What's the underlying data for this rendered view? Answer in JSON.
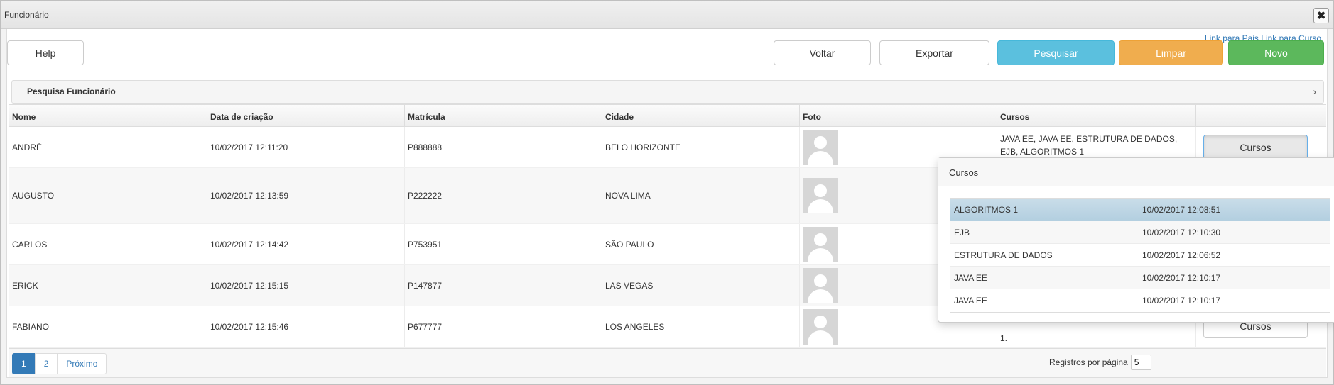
{
  "window": {
    "title": "Funcionário",
    "close_glyph": "✖"
  },
  "links": {
    "pais": "Link para Pais",
    "curso": "Link para Curso"
  },
  "toolbar": {
    "help": "Help",
    "voltar": "Voltar",
    "exportar": "Exportar",
    "pesquisar": "Pesquisar",
    "limpar": "Limpar",
    "novo": "Novo"
  },
  "search_panel": {
    "title": "Pesquisa Funcionário",
    "chevron": "›"
  },
  "table": {
    "headers": [
      "Nome",
      "Data de criação",
      "Matrícula",
      "Cidade",
      "Foto",
      "Cursos",
      ""
    ],
    "rows": [
      {
        "nome": "ANDRÉ",
        "data": "10/02/2017 12:11:20",
        "matricula": "P888888",
        "cidade": "BELO HORIZONTE",
        "cursos": "JAVA EE, JAVA EE, ESTRUTURA DE DADOS, EJB, ALGORITMOS 1",
        "button": "Cursos"
      },
      {
        "nome": "AUGUSTO",
        "data": "10/02/2017 12:13:59",
        "matricula": "P222222",
        "cidade": "NOVA LIMA",
        "cursos": "",
        "button": ""
      },
      {
        "nome": "CARLOS",
        "data": "10/02/2017 12:14:42",
        "matricula": "P753951",
        "cidade": "SÃO PAULO",
        "cursos": "",
        "button": ""
      },
      {
        "nome": "ERICK",
        "data": "10/02/2017 12:15:15",
        "matricula": "P147877",
        "cidade": "LAS VEGAS",
        "cursos": "",
        "button": ""
      },
      {
        "nome": "FABIANO",
        "data": "10/02/2017 12:15:46",
        "matricula": "P677777",
        "cidade": "LOS ANGELES",
        "cursos": "1.",
        "button": "Cursos"
      }
    ]
  },
  "pagination": {
    "pages": [
      "1",
      "2"
    ],
    "next": "Próximo",
    "per_page_label": "Registros por página",
    "per_page_value": "5"
  },
  "popover": {
    "title": "Cursos",
    "rows": [
      {
        "nome": "ALGORITMOS 1",
        "data": "10/02/2017 12:08:51"
      },
      {
        "nome": "EJB",
        "data": "10/02/2017 12:10:30"
      },
      {
        "nome": "ESTRUTURA DE DADOS",
        "data": "10/02/2017 12:06:52"
      },
      {
        "nome": "JAVA EE",
        "data": "10/02/2017 12:10:17"
      },
      {
        "nome": "JAVA EE",
        "data": "10/02/2017 12:10:17"
      }
    ]
  },
  "colors": {
    "primary": "#337ab7",
    "info": "#5bc0de",
    "warning": "#f0ad4e",
    "success": "#5cb85c",
    "selected_row": "#c0d7e6"
  }
}
